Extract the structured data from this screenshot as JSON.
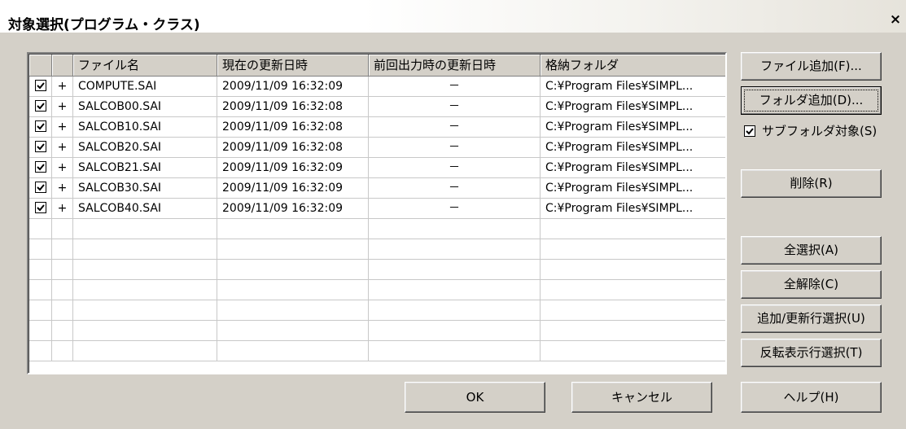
{
  "window": {
    "title": "対象選択(プログラム・クラス)",
    "close": "×"
  },
  "columns": [
    "",
    "",
    "ファイル名",
    "現在の更新日時",
    "前回出力時の更新日時",
    "格納フォルダ"
  ],
  "rows": [
    {
      "checked": true,
      "mark": "+",
      "file": "COMPUTE.SAI",
      "current": "2009/11/09 16:32:09",
      "previous": "－",
      "folder": "C:¥Program Files¥SIMPL..."
    },
    {
      "checked": true,
      "mark": "+",
      "file": "SALCOB00.SAI",
      "current": "2009/11/09 16:32:08",
      "previous": "－",
      "folder": "C:¥Program Files¥SIMPL..."
    },
    {
      "checked": true,
      "mark": "+",
      "file": "SALCOB10.SAI",
      "current": "2009/11/09 16:32:08",
      "previous": "－",
      "folder": "C:¥Program Files¥SIMPL..."
    },
    {
      "checked": true,
      "mark": "+",
      "file": "SALCOB20.SAI",
      "current": "2009/11/09 16:32:08",
      "previous": "－",
      "folder": "C:¥Program Files¥SIMPL..."
    },
    {
      "checked": true,
      "mark": "+",
      "file": "SALCOB21.SAI",
      "current": "2009/11/09 16:32:09",
      "previous": "－",
      "folder": "C:¥Program Files¥SIMPL..."
    },
    {
      "checked": true,
      "mark": "+",
      "file": "SALCOB30.SAI",
      "current": "2009/11/09 16:32:09",
      "previous": "－",
      "folder": "C:¥Program Files¥SIMPL..."
    },
    {
      "checked": true,
      "mark": "+",
      "file": "SALCOB40.SAI",
      "current": "2009/11/09 16:32:09",
      "previous": "－",
      "folder": "C:¥Program Files¥SIMPL..."
    }
  ],
  "buttons": {
    "add_file": "ファイル追加(F)...",
    "add_folder": "フォルダ追加(D)...",
    "subfolder": "サブフォルダ対象(S)",
    "subfolder_checked": true,
    "delete": "削除(R)",
    "select_all": "全選択(A)",
    "deselect_all": "全解除(C)",
    "select_added": "追加/更新行選択(U)",
    "select_highlighted": "反転表示行選択(T)",
    "ok": "OK",
    "cancel": "キャンセル",
    "help": "ヘルプ(H)"
  }
}
